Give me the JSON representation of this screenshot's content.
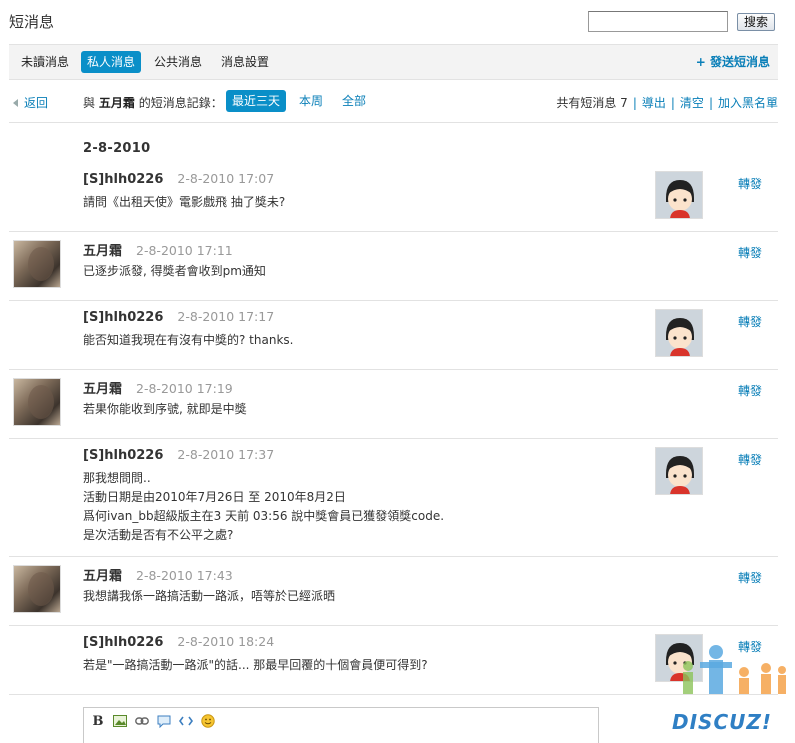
{
  "header": {
    "title": "短消息",
    "search": {
      "value": "",
      "button_label": "搜索"
    }
  },
  "tabs": [
    {
      "label": "未讀消息",
      "active": false
    },
    {
      "label": "私人消息",
      "active": true
    },
    {
      "label": "公共消息",
      "active": false
    },
    {
      "label": "消息設置",
      "active": false
    }
  ],
  "send_link": "+ 發送短消息",
  "filter": {
    "back_label": "返回",
    "prefix": "與",
    "contact": "五月霜",
    "suffix": "的短消息記錄：",
    "ranges": [
      {
        "label": "最近三天",
        "active": true
      },
      {
        "label": "本周",
        "active": false
      },
      {
        "label": "全部",
        "active": false
      }
    ],
    "count_text": "共有短消息 7",
    "actions": [
      "導出",
      "清空",
      "加入黑名單"
    ]
  },
  "date_heading": "2-8-2010",
  "messages": [
    {
      "author": "[S]hlh0226",
      "time": "2-8-2010 17:07",
      "lines": [
        "請問《出租天使》電影戲飛 抽了獎未?"
      ],
      "side": "right",
      "forward": "轉發"
    },
    {
      "author": "五月霜",
      "time": "2-8-2010 17:11",
      "lines": [
        "已逐步派發, 得獎者會收到pm通知"
      ],
      "side": "left",
      "forward": "轉發"
    },
    {
      "author": "[S]hlh0226",
      "time": "2-8-2010 17:17",
      "lines": [
        "能否知道我現在有沒有中獎的? thanks."
      ],
      "side": "right",
      "forward": "轉發"
    },
    {
      "author": "五月霜",
      "time": "2-8-2010 17:19",
      "lines": [
        "若果你能收到序號, 就即是中獎"
      ],
      "side": "left",
      "forward": "轉發"
    },
    {
      "author": "[S]hlh0226",
      "time": "2-8-2010 17:37",
      "lines": [
        "那我想問問..",
        "活動日期是由2010年7月26日 至 2010年8月2日",
        "爲何ivan_bb超級版主在3 天前 03:56 說中獎會員已獲發領獎code.",
        "是次活動是否有不公平之處?"
      ],
      "side": "right",
      "forward": "轉發"
    },
    {
      "author": "五月霜",
      "time": "2-8-2010 17:43",
      "lines": [
        "我想講我係一路搞活動一路派，唔等於已經派晒"
      ],
      "side": "left",
      "forward": "轉發"
    },
    {
      "author": "[S]hlh0226",
      "time": "2-8-2010 18:24",
      "lines": [
        "若是\"一路搞活動一路派\"的話... 那最早回覆的十個會員便可得到?"
      ],
      "side": "right",
      "forward": "轉發"
    }
  ],
  "editor_tools": [
    "bold-icon",
    "image-icon",
    "link-icon",
    "quote-icon",
    "code-icon",
    "smiley-icon"
  ],
  "editor_bold_glyph": "B",
  "watermark": "DISCUZ!"
}
